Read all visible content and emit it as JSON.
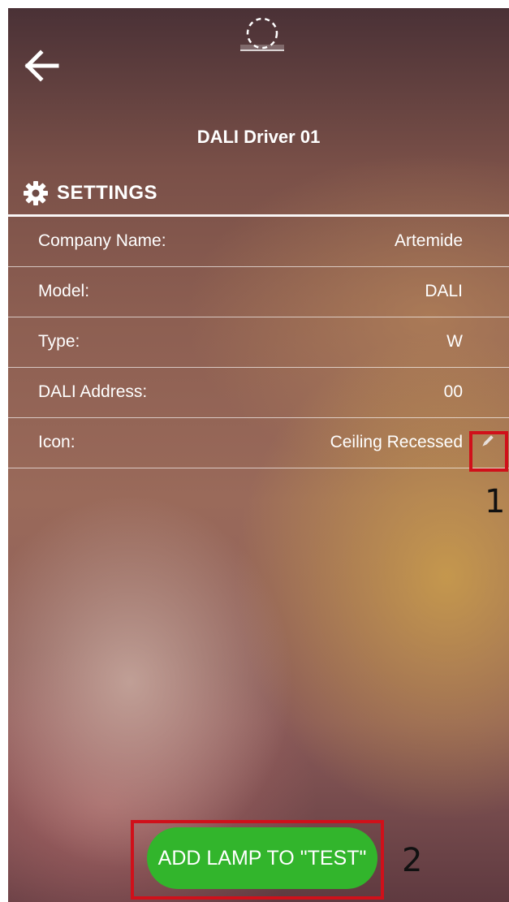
{
  "header": {
    "device_title": "DALI Driver 01"
  },
  "settings": {
    "section_title": "SETTINGS",
    "rows": [
      {
        "label": "Company Name:",
        "value": "Artemide"
      },
      {
        "label": "Model:",
        "value": "DALI"
      },
      {
        "label": "Type:",
        "value": "W"
      },
      {
        "label": "DALI Address:",
        "value": "00"
      },
      {
        "label": "Icon:",
        "value": "Ceiling Recessed"
      }
    ]
  },
  "actions": {
    "add_lamp_label": "ADD LAMP TO \"TEST\""
  },
  "annotations": {
    "edit_icon_marker": "1",
    "add_lamp_marker": "2"
  },
  "icons": {
    "back": "arrow-left-icon",
    "settings": "gear-icon",
    "edit": "pencil-icon",
    "lamp_placeholder": "dashed-circle-icon"
  },
  "colors": {
    "accent_button": "#32b52c",
    "annotation": "#d0101a",
    "text": "#ffffff"
  }
}
